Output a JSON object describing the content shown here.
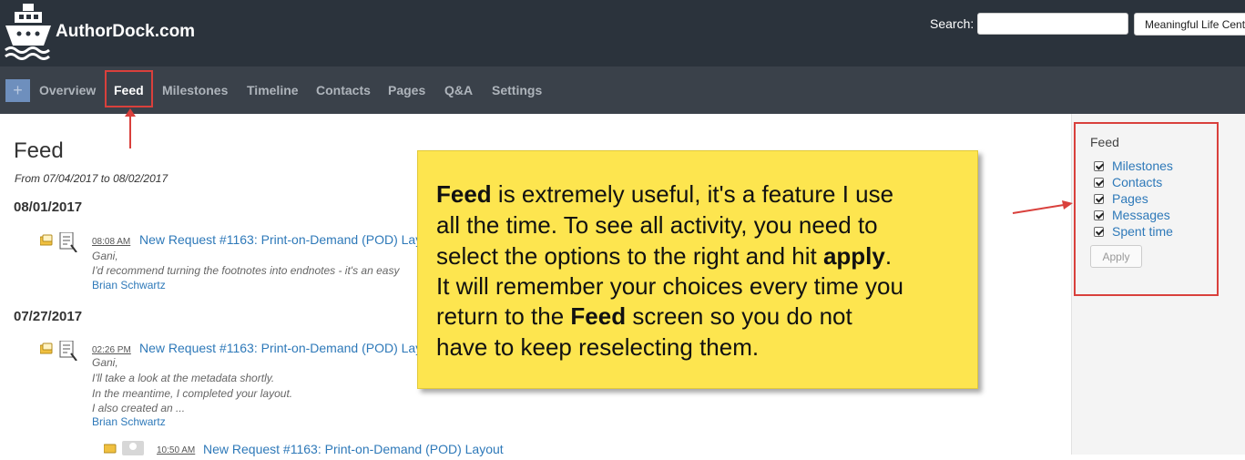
{
  "brand": {
    "name": "AuthorDock.com",
    "logo_icon": "ship-icon"
  },
  "search": {
    "label": "Search:",
    "value": "",
    "project_selected": "Meaningful Life Cent"
  },
  "nav": {
    "plus_label": "+",
    "items": [
      {
        "label": "Overview"
      },
      {
        "label": "Feed",
        "active": true
      },
      {
        "label": "Milestones"
      },
      {
        "label": "Timeline"
      },
      {
        "label": "Contacts"
      },
      {
        "label": "Pages"
      },
      {
        "label": "Q&A"
      },
      {
        "label": "Settings"
      }
    ]
  },
  "page": {
    "title": "Feed",
    "date_range": "From 07/04/2017 to 08/02/2017"
  },
  "feed": [
    {
      "date": "08/01/2017",
      "entries": [
        {
          "time": "08:08 AM",
          "title": "New Request #1163: Print-on-Demand (POD) Lay",
          "lines": [
            "Gani,",
            "I'd recommend turning the footnotes into endnotes - it's an easy"
          ],
          "author": "Brian Schwartz"
        }
      ]
    },
    {
      "date": "07/27/2017",
      "entries": [
        {
          "time": "02:26 PM",
          "title": "New Request #1163: Print-on-Demand (POD) Lay",
          "lines": [
            "Gani,",
            "I'll take a look at the metadata shortly.",
            "In the meantime, I completed your layout.",
            "I also created an ..."
          ],
          "author": "Brian Schwartz"
        },
        {
          "time": "10:50 AM",
          "title": "New Request #1163: Print-on-Demand (POD) Layout",
          "lines": [],
          "author": ""
        }
      ]
    }
  ],
  "filters": {
    "title": "Feed",
    "options": [
      {
        "label": "Milestones",
        "checked": true
      },
      {
        "label": "Contacts",
        "checked": true
      },
      {
        "label": "Pages",
        "checked": true
      },
      {
        "label": "Messages",
        "checked": true
      },
      {
        "label": "Spent time",
        "checked": true
      }
    ],
    "apply_label": "Apply"
  },
  "callout": {
    "lines": [
      [
        "Feed",
        " is extremely useful, it's a feature I use"
      ],
      [
        "",
        "all the time.  To see all activity, you need to"
      ],
      [
        "",
        "select the options to the right and hit ",
        "apply",
        "."
      ],
      [
        "",
        "It will remember your choices every time you"
      ],
      [
        "",
        "return to the ",
        "Feed",
        " screen so you do not"
      ],
      [
        "",
        "have to keep reselecting them."
      ]
    ]
  },
  "colors": {
    "topbar": "#2b333c",
    "navbar": "#3a414a",
    "link": "#2e79b9",
    "highlight": "#d9403c",
    "callout": "#fde54f"
  }
}
